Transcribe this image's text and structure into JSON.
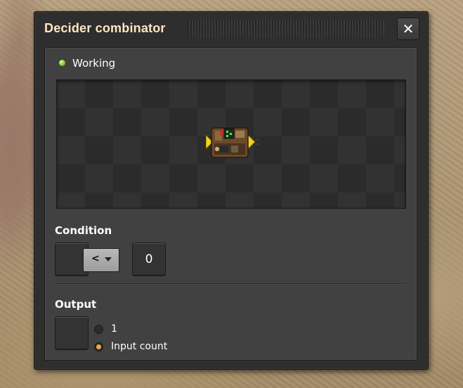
{
  "window": {
    "title": "Decider combinator",
    "close_label": "✕"
  },
  "status": {
    "label": "Working",
    "indicator_color": "#7fcd2f"
  },
  "condition": {
    "label": "Condition",
    "comparator": "<",
    "constant": "0"
  },
  "output": {
    "label": "Output",
    "options": [
      {
        "label": "1",
        "selected": false
      },
      {
        "label": "Input count",
        "selected": true
      }
    ],
    "selected_color": "#f2a73b"
  },
  "icons": {
    "close": "close-icon",
    "status": "status-led-icon",
    "entity": "decider-combinator-icon",
    "dropdown": "chevron-down-icon"
  }
}
